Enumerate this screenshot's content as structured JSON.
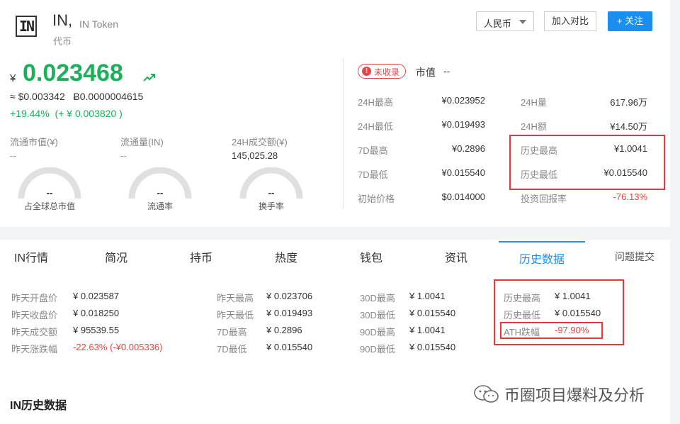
{
  "header": {
    "logo_text": "IN",
    "symbol": "IN,",
    "full_name": "IN Token",
    "type": "代币",
    "currency_select": "人民币",
    "compare_button": "加入对比",
    "follow_button": "+ 关注"
  },
  "price": {
    "yen": "¥",
    "value": "0.023468",
    "converted": "≈ $0.003342   Ƀ0.0000004615",
    "change": "+19.44%  (+ ¥ 0.003820 )"
  },
  "stats": {
    "circ_mcap_label": "流通市值(¥)",
    "circ_mcap_value": "--",
    "circ_supply_label": "流通量(IN)",
    "circ_supply_value": "--",
    "vol24_label": "24H成交额(¥)",
    "vol24_value": "145,025.28"
  },
  "gauges": [
    {
      "value": "--",
      "caption": "占全球总市值"
    },
    {
      "value": "--",
      "caption": "流通率"
    },
    {
      "value": "--",
      "caption": "换手率"
    }
  ],
  "market": {
    "badge": "未收录",
    "mcap_label": "市值",
    "mcap_value": "--",
    "left": [
      {
        "label": "24H最高",
        "value": "¥0.023952"
      },
      {
        "label": "24H最低",
        "value": "¥0.019493"
      },
      {
        "label": "7D最高",
        "value": "¥0.2896"
      },
      {
        "label": "7D最低",
        "value": "¥0.015540"
      },
      {
        "label": "初始价格",
        "value": "$0.014000"
      }
    ],
    "right": [
      {
        "label": "24H量",
        "value": "617.96万"
      },
      {
        "label": "24H额",
        "value": "¥14.50万"
      },
      {
        "label": "历史最高",
        "value": "¥1.0041"
      },
      {
        "label": "历史最低",
        "value": "¥0.015540"
      },
      {
        "label": "投资回报率",
        "value": "-76.13%"
      }
    ]
  },
  "tabs": [
    "IN行情",
    "简况",
    "持币",
    "热度",
    "钱包",
    "资讯",
    "历史数据",
    "问题提交"
  ],
  "history": {
    "col1": [
      {
        "label": "昨天开盘价",
        "value": "¥ 0.023587"
      },
      {
        "label": "昨天收盘价",
        "value": "¥ 0.018250"
      },
      {
        "label": "昨天成交额",
        "value": "¥ 95539.55"
      },
      {
        "label": "昨天涨跌幅",
        "value": "-22.63% (-¥0.005336)"
      }
    ],
    "col2": [
      {
        "label": "昨天最高",
        "value": "¥ 0.023706"
      },
      {
        "label": "昨天最低",
        "value": "¥ 0.019493"
      },
      {
        "label": "7D最高",
        "value": "¥ 0.2896"
      },
      {
        "label": "7D最低",
        "value": "¥ 0.015540"
      }
    ],
    "col3": [
      {
        "label": "30D最高",
        "value": "¥ 1.0041"
      },
      {
        "label": "30D最低",
        "value": "¥ 0.015540"
      },
      {
        "label": "90D最高",
        "value": "¥ 1.0041"
      },
      {
        "label": "90D最低",
        "value": "¥ 0.015540"
      }
    ],
    "col4": [
      {
        "label": "历史最高",
        "value": "¥ 1.0041"
      },
      {
        "label": "历史最低",
        "value": "¥ 0.015540"
      },
      {
        "label": "ATH跌幅",
        "value": "-97.90%"
      }
    ]
  },
  "section_title": "IN历史数据",
  "watermark": "币圈项目爆料及分析",
  "colors": {
    "up": "#1db05a",
    "down": "#e54545",
    "accent": "#1a8ff0"
  }
}
